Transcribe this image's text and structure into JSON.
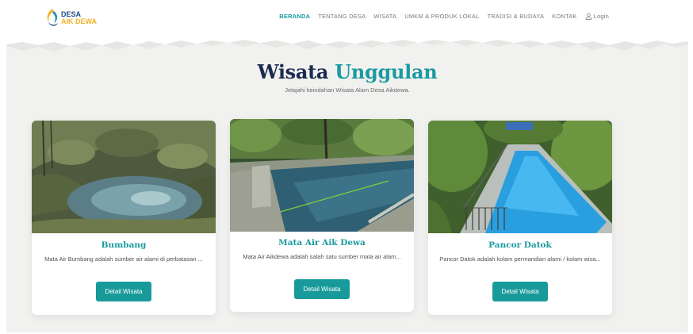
{
  "brand": {
    "line1": "DESA",
    "line2": "AIK DEWA"
  },
  "nav": {
    "items": [
      "BERANDA",
      "TENTANG DESA",
      "WISATA",
      "UMKM & PRODUK LOKAL",
      "TRADISI & BUDAYA",
      "KONTAK"
    ],
    "active": "BERANDA",
    "login": "Login"
  },
  "hero": {
    "title_main": "Wisata",
    "title_accent": "Unggulan",
    "subtitle": "Jelajahi keindahan Wisata Alam Desa Aikdewa."
  },
  "cards": [
    {
      "title": "Bumbang",
      "description": "Mata Air Bumbang adalah sumber air alami di perbatasan ...",
      "button": "Detail Wisata"
    },
    {
      "title": "Mata Air Aik Dewa",
      "description": "Mata Air Aikdewa adalah salah satu sumber mata air alam...",
      "button": "Detail Wisata"
    },
    {
      "title": "Pancor Datok",
      "description": "Pancor Datok adalah kolam permandian alami / kolam wisa...",
      "button": "Detail Wisata"
    }
  ],
  "colors": {
    "accent": "#1b9aa0",
    "heading": "#1a2c4e",
    "button": "#179a99",
    "background": "#f1f1f0"
  }
}
